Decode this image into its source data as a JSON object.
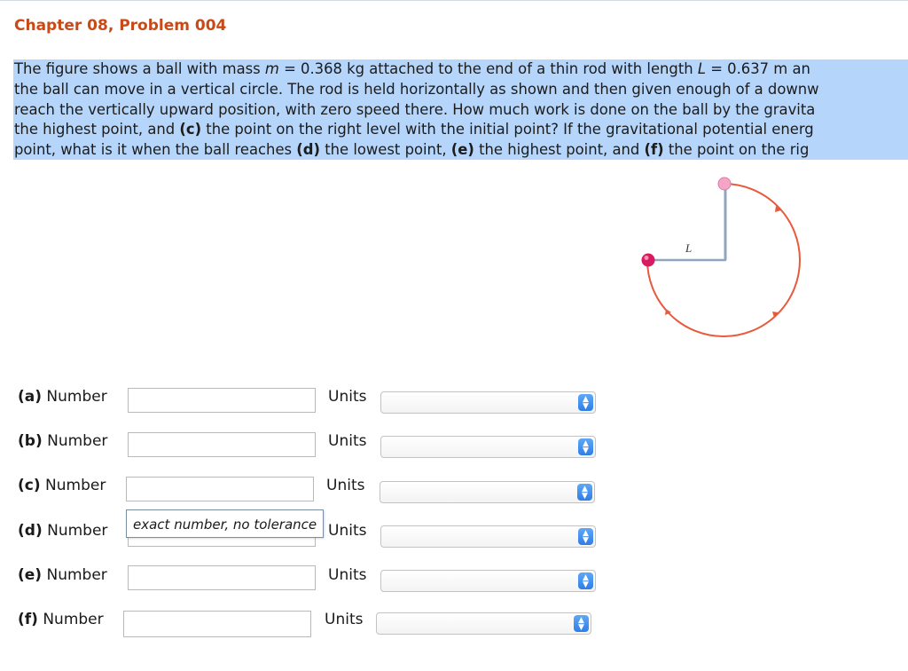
{
  "header": {
    "title": "Chapter 08, Problem 004"
  },
  "problem": {
    "line1": {
      "a": "The figure shows a ball with mass ",
      "m": "m",
      "b": " = 0.368 kg attached to the end of a thin rod with length ",
      "L": "L",
      "c": " = 0.637 m an"
    },
    "line2": "the ball can move in a vertical circle. The rod is held horizontally as shown and then given enough of a downw",
    "line3": "reach the vertically upward position, with zero speed there. How much work is done on the ball by the gravita",
    "line4": {
      "a": "the highest point, and ",
      "c": "(c)",
      "b": " the point on the right level with the initial point? If the gravitational potential energ"
    },
    "line5": {
      "a": "point, what is it when the ball reaches ",
      "d": "(d)",
      "b": " the lowest point, ",
      "e": "(e)",
      "c": " the highest point, and ",
      "f": "(f)",
      "g": " the point on the rig"
    }
  },
  "figure": {
    "rod_label": "L",
    "arc_color": "#e85a3c",
    "rod_color": "#8fa6bd",
    "ball_color": "#d81b60",
    "top_ball_color": "#f4a6c6"
  },
  "questions": [
    {
      "part": "(a)",
      "label": "Number",
      "value": "",
      "units_label": "Units",
      "units_value": ""
    },
    {
      "part": "(b)",
      "label": "Number",
      "value": "",
      "units_label": "Units",
      "units_value": ""
    },
    {
      "part": "(c)",
      "label": "Number",
      "value": "",
      "units_label": "Units",
      "units_value": ""
    },
    {
      "part": "(d)",
      "label": "Number",
      "value": "",
      "units_label": "Units",
      "units_value": ""
    },
    {
      "part": "(e)",
      "label": "Number",
      "value": "",
      "units_label": "Units",
      "units_value": ""
    },
    {
      "part": "(f)",
      "label": "Number",
      "value": "",
      "units_label": "Units",
      "units_value": ""
    }
  ],
  "tooltip": {
    "text": "exact number, no tolerance"
  },
  "icons": {
    "select_arrow": "chevron-up-down-icon"
  },
  "colors": {
    "title": "#c94a16",
    "highlight": "#b5d5fb",
    "select_arrow": "#2f7de8"
  }
}
